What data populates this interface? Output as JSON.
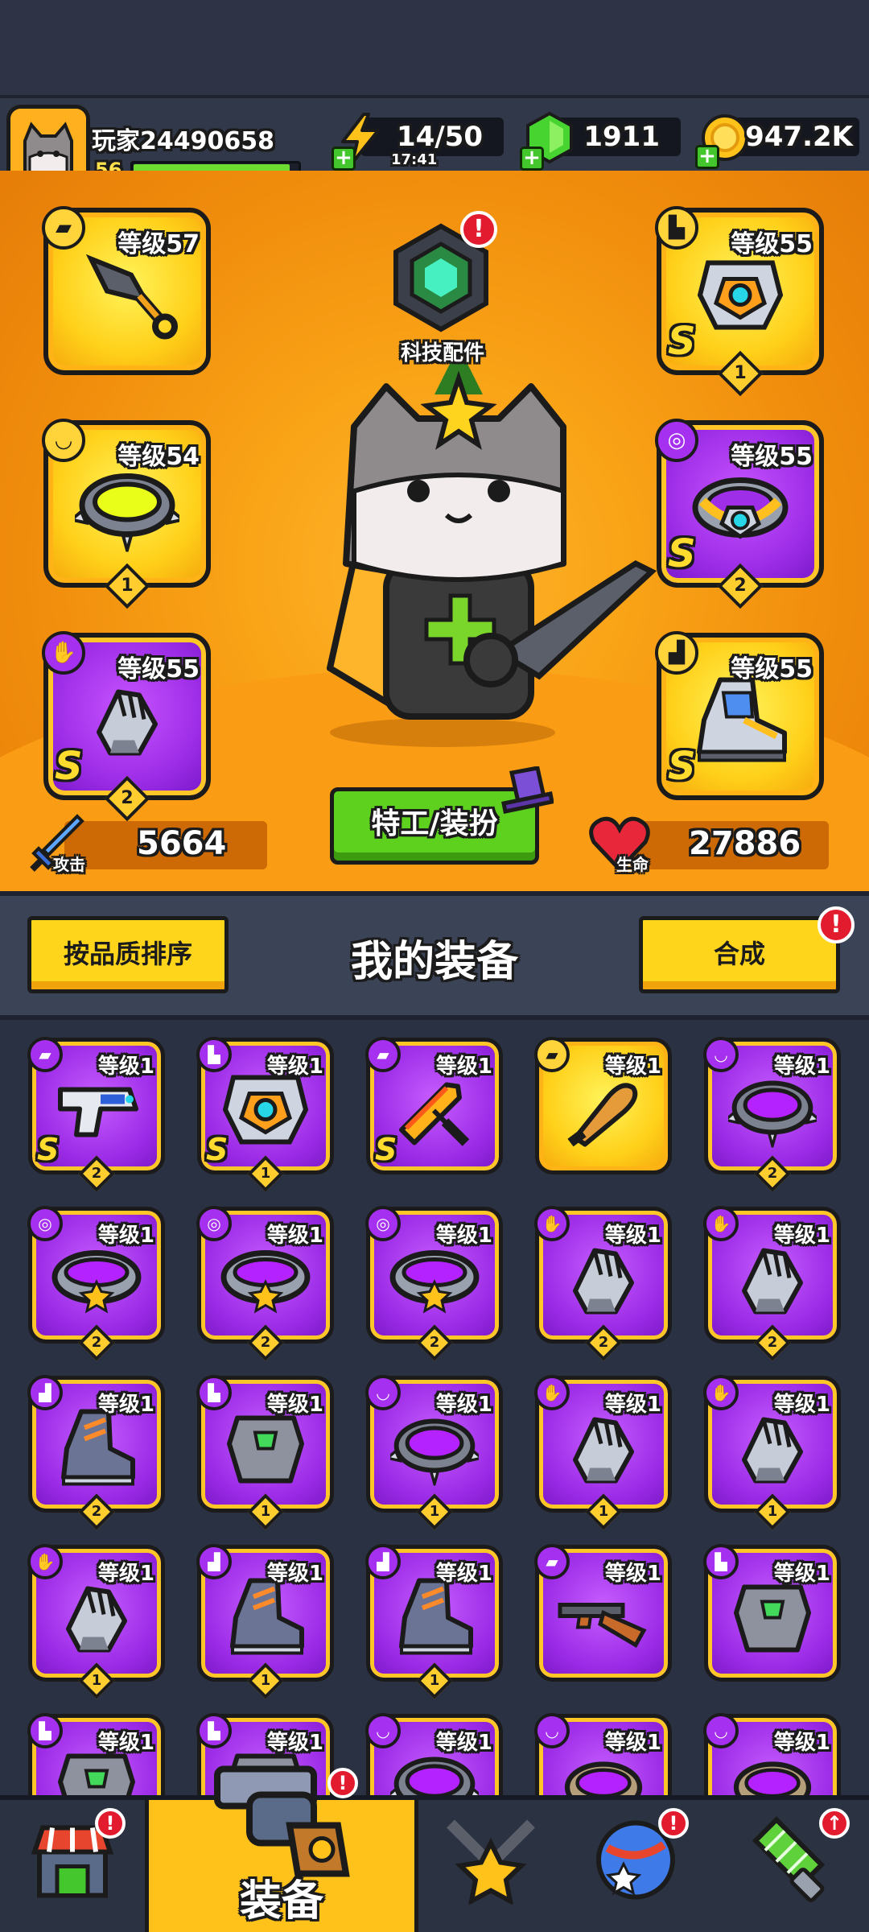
{
  "player": {
    "name": "玩家24490658",
    "level": "56",
    "xp_fraction": 0.95
  },
  "resources": {
    "energy": {
      "value": "14/50",
      "timer": "17:41",
      "icon": "lightning-icon"
    },
    "gems": {
      "value": "1911",
      "icon": "green-gem-icon"
    },
    "coins": {
      "value": "947.2K",
      "icon": "gold-coin-icon"
    }
  },
  "tech_parts": {
    "label": "科技配件",
    "alert": "!"
  },
  "equipped": [
    {
      "slot": "weapon",
      "level_label": "等级57",
      "badge_icon": "gun-icon",
      "art": "kunai-icon",
      "rarity": "gold",
      "grade": "",
      "stars": ""
    },
    {
      "slot": "necklace",
      "level_label": "等级54",
      "badge_icon": "necklace-icon",
      "art": "spiked-collar-icon",
      "rarity": "gold",
      "grade": "",
      "stars": "1"
    },
    {
      "slot": "gloves",
      "level_label": "等级55",
      "badge_icon": "glove-icon",
      "art": "gauntlet-icon",
      "rarity": "purple",
      "grade": "S",
      "stars": "2"
    },
    {
      "slot": "armor",
      "level_label": "等级55",
      "badge_icon": "shirt-icon",
      "art": "mech-armor-icon",
      "rarity": "gold",
      "grade": "S",
      "stars": "1"
    },
    {
      "slot": "belt",
      "level_label": "等级55",
      "badge_icon": "belt-icon",
      "art": "mech-belt-icon",
      "rarity": "purple",
      "grade": "S",
      "stars": "2"
    },
    {
      "slot": "boots",
      "level_label": "等级55",
      "badge_icon": "boot-icon",
      "art": "mech-boots-icon",
      "rarity": "gold",
      "grade": "S",
      "stars": ""
    }
  ],
  "stats": {
    "attack": {
      "label": "攻击",
      "value": "5664"
    },
    "hp": {
      "label": "生命",
      "value": "27886"
    }
  },
  "costume_button": "特工/装扮",
  "equipment_section": {
    "sort_button": "按品质排序",
    "title": "我的装备",
    "merge_button": "合成",
    "merge_alert": "!"
  },
  "inventory": [
    {
      "level_label": "等级1",
      "badge": "gun-icon",
      "art": "blaster-icon",
      "rarity": "purple",
      "grade": "S",
      "stars": "2"
    },
    {
      "level_label": "等级1",
      "badge": "shirt-icon",
      "art": "mech-armor-icon",
      "rarity": "purple",
      "grade": "S",
      "stars": "1"
    },
    {
      "level_label": "等级1",
      "badge": "gun-icon",
      "art": "flame-sword-icon",
      "rarity": "purple",
      "grade": "S",
      "stars": ""
    },
    {
      "level_label": "等级1",
      "badge": "gun-icon",
      "art": "bat-icon",
      "rarity": "gold",
      "grade": "",
      "stars": ""
    },
    {
      "level_label": "等级1",
      "badge": "necklace-icon",
      "art": "spiked-collar-icon",
      "rarity": "purple",
      "grade": "",
      "stars": "2"
    },
    {
      "level_label": "等级1",
      "badge": "belt-icon",
      "art": "star-belt-icon",
      "rarity": "purple",
      "grade": "",
      "stars": "2"
    },
    {
      "level_label": "等级1",
      "badge": "belt-icon",
      "art": "star-belt-icon",
      "rarity": "purple",
      "grade": "",
      "stars": "2"
    },
    {
      "level_label": "等级1",
      "badge": "belt-icon",
      "art": "star-belt-icon",
      "rarity": "purple",
      "grade": "",
      "stars": "2"
    },
    {
      "level_label": "等级1",
      "badge": "glove-icon",
      "art": "gauntlet-icon",
      "rarity": "purple",
      "grade": "",
      "stars": "2"
    },
    {
      "level_label": "等级1",
      "badge": "glove-icon",
      "art": "gauntlet-icon",
      "rarity": "purple",
      "grade": "",
      "stars": "2"
    },
    {
      "level_label": "等级1",
      "badge": "boot-icon",
      "art": "boot-icon",
      "rarity": "purple",
      "grade": "",
      "stars": "2"
    },
    {
      "level_label": "等级1",
      "badge": "shirt-icon",
      "art": "chest-armor-icon",
      "rarity": "purple",
      "grade": "",
      "stars": "1"
    },
    {
      "level_label": "等级1",
      "badge": "necklace-icon",
      "art": "spiked-collar-icon",
      "rarity": "purple",
      "grade": "",
      "stars": "1"
    },
    {
      "level_label": "等级1",
      "badge": "glove-icon",
      "art": "gauntlet-icon",
      "rarity": "purple",
      "grade": "",
      "stars": "1"
    },
    {
      "level_label": "等级1",
      "badge": "glove-icon",
      "art": "gauntlet-icon",
      "rarity": "purple",
      "grade": "",
      "stars": "1"
    },
    {
      "level_label": "等级1",
      "badge": "glove-icon",
      "art": "gauntlet-icon",
      "rarity": "purple",
      "grade": "",
      "stars": "1"
    },
    {
      "level_label": "等级1",
      "badge": "boot-icon",
      "art": "boot-icon",
      "rarity": "purple",
      "grade": "",
      "stars": "1"
    },
    {
      "level_label": "等级1",
      "badge": "boot-icon",
      "art": "boot-icon",
      "rarity": "purple",
      "grade": "",
      "stars": "1"
    },
    {
      "level_label": "等级1",
      "badge": "gun-icon",
      "art": "shotgun-icon",
      "rarity": "purple",
      "grade": "",
      "stars": ""
    },
    {
      "level_label": "等级1",
      "badge": "shirt-icon",
      "art": "chest-armor-icon",
      "rarity": "purple",
      "grade": "",
      "stars": ""
    },
    {
      "level_label": "等级1",
      "badge": "shirt-icon",
      "art": "chest-armor-icon",
      "rarity": "purple",
      "grade": "",
      "stars": ""
    },
    {
      "level_label": "等级1",
      "badge": "shirt-icon",
      "art": "chest-armor-icon",
      "rarity": "purple",
      "grade": "",
      "stars": ""
    },
    {
      "level_label": "等级1",
      "badge": "necklace-icon",
      "art": "spiked-collar-icon",
      "rarity": "purple",
      "grade": "",
      "stars": ""
    },
    {
      "level_label": "等级1",
      "badge": "necklace-icon",
      "art": "ring-collar-icon",
      "rarity": "purple",
      "grade": "",
      "stars": ""
    },
    {
      "level_label": "等级1",
      "badge": "necklace-icon",
      "art": "ring-collar-icon",
      "rarity": "purple",
      "grade": "",
      "stars": ""
    }
  ],
  "bottom_nav": [
    {
      "id": "shop",
      "icon": "shop-icon",
      "label": "",
      "alert": "!",
      "active": false
    },
    {
      "id": "equipment",
      "icon": "revolver-icon",
      "label": "装备",
      "alert": "!",
      "active": true
    },
    {
      "id": "battle",
      "icon": "star-swords-icon",
      "label": "",
      "alert": "",
      "active": false
    },
    {
      "id": "orbs",
      "icon": "star-orb-icon",
      "label": "",
      "alert": "!",
      "active": false
    },
    {
      "id": "evolve",
      "icon": "dna-capsule-icon",
      "label": "",
      "alert": "↑",
      "active": false
    }
  ],
  "colors": {
    "hero_bg": "#f9a216",
    "purple_rarity": "#9f2ee8",
    "gold_rarity": "#ffd019",
    "green_button": "#5ed11f",
    "yellow_button": "#ffd51c",
    "alert_red": "#e31b2e"
  }
}
